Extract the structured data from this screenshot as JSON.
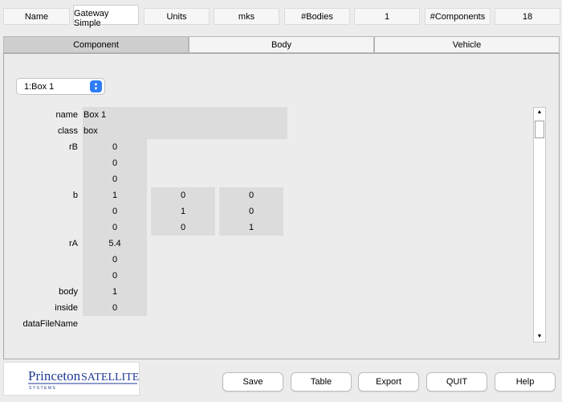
{
  "header": {
    "name_label": "Name",
    "name_value": "Gateway Simple",
    "units_label": "Units",
    "units_value": "mks",
    "bodies_label": "#Bodies",
    "bodies_value": "1",
    "components_label": "#Components",
    "components_value": "18"
  },
  "tabs": [
    {
      "label": "Component",
      "active": true
    },
    {
      "label": "Body",
      "active": false
    },
    {
      "label": "Vehicle",
      "active": false
    }
  ],
  "component_select": {
    "selected": "1:Box 1"
  },
  "fields": {
    "name": {
      "label": "name",
      "value": "Box 1"
    },
    "class": {
      "label": "class",
      "value": "box"
    },
    "rB": {
      "label": "rB",
      "values": [
        "0",
        "0",
        "0"
      ]
    },
    "b": {
      "label": "b",
      "matrix": [
        [
          "1",
          "0",
          "0"
        ],
        [
          "0",
          "1",
          "0"
        ],
        [
          "0",
          "0",
          "1"
        ]
      ]
    },
    "rA": {
      "label": "rA",
      "values": [
        "5.4",
        "0",
        "0"
      ]
    },
    "body": {
      "label": "body",
      "value": "1"
    },
    "inside": {
      "label": "inside",
      "value": "0"
    },
    "dataFileName": {
      "label": "dataFileName",
      "value": ""
    }
  },
  "logo": {
    "princeton": "Princeton",
    "satellite": "SATELLITE",
    "systems": "SYSTEMS"
  },
  "buttons": {
    "save": "Save",
    "table": "Table",
    "export": "Export",
    "quit": "QUIT",
    "help": "Help"
  },
  "colors": {
    "popup_accent": "#2f7df6",
    "field_bg": "#dcdcdc",
    "active_tab": "#cfcfcf",
    "logo_blue": "#1f3a93"
  }
}
